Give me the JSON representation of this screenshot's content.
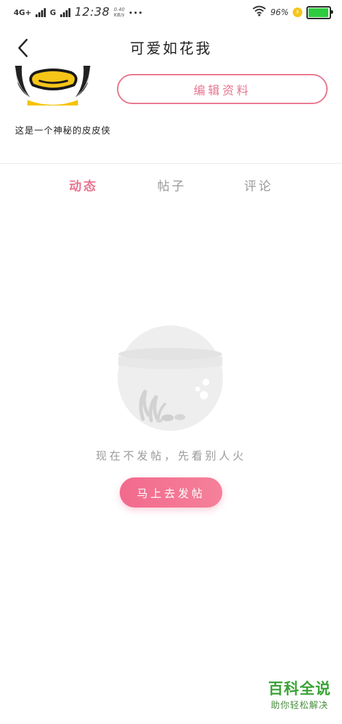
{
  "status_bar": {
    "network_label": "4G+",
    "network_label_2": "G",
    "time": "12:38",
    "speed_value": "0.40",
    "speed_unit": "KB/s",
    "more_dots": "···",
    "battery_percent": "96%",
    "battery_level": 0.96,
    "battery_color": "#2ecc40"
  },
  "header": {
    "title": "可爱如花我",
    "back_icon": "chevron-left-icon"
  },
  "profile": {
    "avatar_icon": "cartoon-avatar",
    "edit_button_label": "编辑资料",
    "bio": "这是一个神秘的皮皮侠"
  },
  "tabs": [
    {
      "label": "动态",
      "active": true
    },
    {
      "label": "帖子",
      "active": false
    },
    {
      "label": "评论",
      "active": false
    }
  ],
  "empty_state": {
    "illustration_icon": "empty-fishbowl-icon",
    "message": "现在不发帖，先看别人火",
    "action_label": "马上去发帖"
  },
  "watermark": {
    "title": "百科全说",
    "subtitle": "助你轻松解决"
  },
  "colors": {
    "accent": "#e8758f",
    "button_gradient_start": "#f26a8d",
    "button_gradient_end": "#f5819a",
    "watermark_green": "#3aa335"
  }
}
